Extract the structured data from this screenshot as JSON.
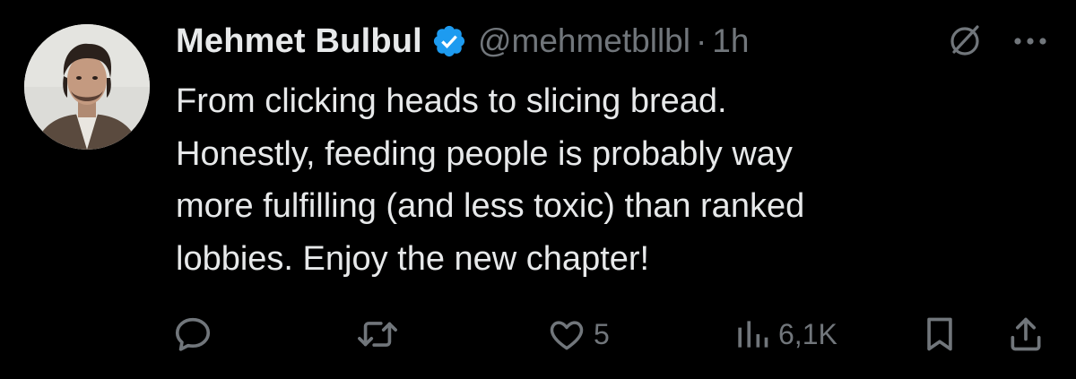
{
  "tweet": {
    "author": {
      "display_name": "Mehmet Bulbul",
      "handle": "@mehmetbllbl",
      "verified": true
    },
    "separator": "·",
    "time": "1h",
    "text_lines": [
      "From clicking heads to slicing bread.",
      "Honestly, feeding people is probably way",
      "more fulfilling (and less toxic) than ranked",
      "lobbies. Enjoy the new chapter!"
    ]
  },
  "actions": {
    "reply": {
      "icon": "reply-icon",
      "count": ""
    },
    "repost": {
      "icon": "repost-icon",
      "count": ""
    },
    "like": {
      "icon": "heart-icon",
      "count": "5"
    },
    "views": {
      "icon": "views-icon",
      "count": "6,1K"
    },
    "bookmark": {
      "icon": "bookmark-icon"
    },
    "share": {
      "icon": "share-icon"
    }
  },
  "header_icons": [
    "grok-icon",
    "more-icon"
  ],
  "colors": {
    "background": "#000000",
    "text": "#e7e9ea",
    "muted": "#71767b",
    "verified": "#1d9bf0"
  }
}
